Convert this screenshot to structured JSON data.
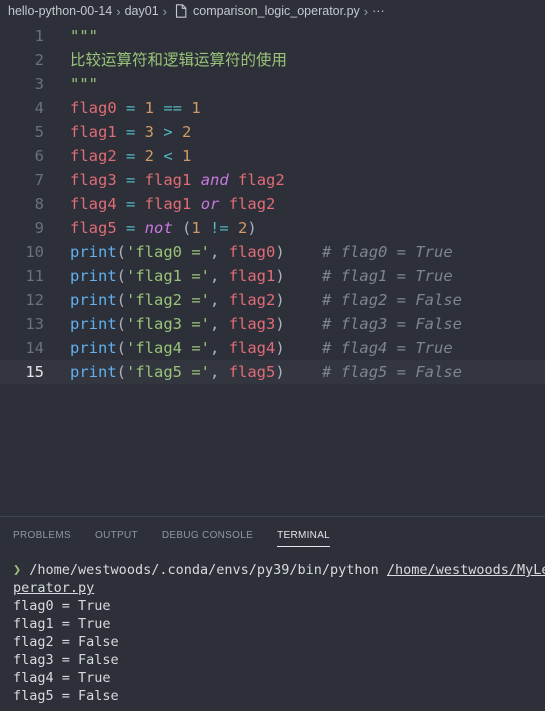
{
  "breadcrumb": {
    "project": "hello-python-00-14",
    "folder": "day01",
    "file": "comparison_logic_operator.py",
    "more": "···"
  },
  "editor": {
    "lines": [
      {
        "n": "1",
        "tokens": [
          {
            "t": "\"\"\"",
            "c": "str"
          }
        ]
      },
      {
        "n": "2",
        "tokens": [
          {
            "t": "比较运算符和逻辑运算符的使用",
            "c": "str"
          }
        ]
      },
      {
        "n": "3",
        "tokens": [
          {
            "t": "\"\"\"",
            "c": "str"
          }
        ]
      },
      {
        "n": "4",
        "tokens": [
          {
            "t": "flag0",
            "c": "var"
          },
          {
            "t": " = ",
            "c": "op"
          },
          {
            "t": "1",
            "c": "num"
          },
          {
            "t": " == ",
            "c": "op"
          },
          {
            "t": "1",
            "c": "num"
          }
        ]
      },
      {
        "n": "5",
        "tokens": [
          {
            "t": "flag1",
            "c": "var"
          },
          {
            "t": " = ",
            "c": "op"
          },
          {
            "t": "3",
            "c": "num"
          },
          {
            "t": " > ",
            "c": "op"
          },
          {
            "t": "2",
            "c": "num"
          }
        ]
      },
      {
        "n": "6",
        "tokens": [
          {
            "t": "flag2",
            "c": "var"
          },
          {
            "t": " = ",
            "c": "op"
          },
          {
            "t": "2",
            "c": "num"
          },
          {
            "t": " < ",
            "c": "op"
          },
          {
            "t": "1",
            "c": "num"
          }
        ]
      },
      {
        "n": "7",
        "tokens": [
          {
            "t": "flag3",
            "c": "var"
          },
          {
            "t": " = ",
            "c": "op"
          },
          {
            "t": "flag1",
            "c": "var"
          },
          {
            "t": " ",
            "c": "pun"
          },
          {
            "t": "and",
            "c": "kw"
          },
          {
            "t": " ",
            "c": "pun"
          },
          {
            "t": "flag2",
            "c": "var"
          }
        ]
      },
      {
        "n": "8",
        "tokens": [
          {
            "t": "flag4",
            "c": "var"
          },
          {
            "t": " = ",
            "c": "op"
          },
          {
            "t": "flag1",
            "c": "var"
          },
          {
            "t": " ",
            "c": "pun"
          },
          {
            "t": "or",
            "c": "kw"
          },
          {
            "t": " ",
            "c": "pun"
          },
          {
            "t": "flag2",
            "c": "var"
          }
        ]
      },
      {
        "n": "9",
        "tokens": [
          {
            "t": "flag5",
            "c": "var"
          },
          {
            "t": " = ",
            "c": "op"
          },
          {
            "t": "not",
            "c": "kw"
          },
          {
            "t": " (",
            "c": "pun"
          },
          {
            "t": "1",
            "c": "num"
          },
          {
            "t": " != ",
            "c": "op"
          },
          {
            "t": "2",
            "c": "num"
          },
          {
            "t": ")",
            "c": "pun"
          }
        ]
      },
      {
        "n": "10",
        "tokens": [
          {
            "t": "print",
            "c": "fn"
          },
          {
            "t": "(",
            "c": "pun"
          },
          {
            "t": "'flag0 ='",
            "c": "str"
          },
          {
            "t": ", ",
            "c": "pun"
          },
          {
            "t": "flag0",
            "c": "var"
          },
          {
            "t": ")",
            "c": "pun"
          },
          {
            "t": "    ",
            "c": "pun"
          },
          {
            "t": "# flag0 = True",
            "c": "com"
          }
        ]
      },
      {
        "n": "11",
        "tokens": [
          {
            "t": "print",
            "c": "fn"
          },
          {
            "t": "(",
            "c": "pun"
          },
          {
            "t": "'flag1 ='",
            "c": "str"
          },
          {
            "t": ", ",
            "c": "pun"
          },
          {
            "t": "flag1",
            "c": "var"
          },
          {
            "t": ")",
            "c": "pun"
          },
          {
            "t": "    ",
            "c": "pun"
          },
          {
            "t": "# flag1 = True",
            "c": "com"
          }
        ]
      },
      {
        "n": "12",
        "tokens": [
          {
            "t": "print",
            "c": "fn"
          },
          {
            "t": "(",
            "c": "pun"
          },
          {
            "t": "'flag2 ='",
            "c": "str"
          },
          {
            "t": ", ",
            "c": "pun"
          },
          {
            "t": "flag2",
            "c": "var"
          },
          {
            "t": ")",
            "c": "pun"
          },
          {
            "t": "    ",
            "c": "pun"
          },
          {
            "t": "# flag2 = False",
            "c": "com"
          }
        ]
      },
      {
        "n": "13",
        "tokens": [
          {
            "t": "print",
            "c": "fn"
          },
          {
            "t": "(",
            "c": "pun"
          },
          {
            "t": "'flag3 ='",
            "c": "str"
          },
          {
            "t": ", ",
            "c": "pun"
          },
          {
            "t": "flag3",
            "c": "var"
          },
          {
            "t": ")",
            "c": "pun"
          },
          {
            "t": "    ",
            "c": "pun"
          },
          {
            "t": "# flag3 = False",
            "c": "com"
          }
        ]
      },
      {
        "n": "14",
        "tokens": [
          {
            "t": "print",
            "c": "fn"
          },
          {
            "t": "(",
            "c": "pun"
          },
          {
            "t": "'flag4 ='",
            "c": "str"
          },
          {
            "t": ", ",
            "c": "pun"
          },
          {
            "t": "flag4",
            "c": "var"
          },
          {
            "t": ")",
            "c": "pun"
          },
          {
            "t": "    ",
            "c": "pun"
          },
          {
            "t": "# flag4 = True",
            "c": "com"
          }
        ]
      },
      {
        "n": "15",
        "active": true,
        "tokens": [
          {
            "t": "print",
            "c": "fn"
          },
          {
            "t": "(",
            "c": "pun"
          },
          {
            "t": "'flag5 ='",
            "c": "str"
          },
          {
            "t": ", ",
            "c": "pun"
          },
          {
            "t": "flag5",
            "c": "var"
          },
          {
            "t": ")",
            "c": "pun"
          },
          {
            "t": "    ",
            "c": "pun"
          },
          {
            "t": "# flag5 = False",
            "c": "com"
          }
        ]
      }
    ]
  },
  "panel": {
    "tabs": [
      {
        "label": "PROBLEMS",
        "active": false
      },
      {
        "label": "OUTPUT",
        "active": false
      },
      {
        "label": "DEBUG CONSOLE",
        "active": false
      },
      {
        "label": "TERMINAL",
        "active": true
      }
    ]
  },
  "terminal": {
    "prompt": "❯",
    "interpreter": "/home/westwoods/.conda/envs/py39/bin/python",
    "script_start": "/home/westwoods/MyLea",
    "script_end": "perator.py",
    "output": [
      "flag0 = True",
      "flag1 = True",
      "flag2 = False",
      "flag3 = False",
      "flag4 = True",
      "flag5 = False"
    ]
  },
  "colors": {
    "background": "#2d3038",
    "string": "#98c379",
    "variable": "#e06c75",
    "operator": "#56b6c2",
    "number": "#d19a66",
    "keyword": "#c678dd",
    "function": "#61afef",
    "comment": "#7f848e"
  }
}
